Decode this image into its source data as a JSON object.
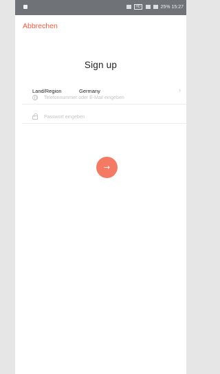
{
  "status_bar": {
    "right_text": "25% 15:27"
  },
  "nav": {
    "cancel_label": "Abbrechen"
  },
  "title": "Sign up",
  "region": {
    "label": "Land/Region",
    "value": "Germany",
    "chevron": "›"
  },
  "phone_field": {
    "placeholder": "Telefonnummer oder E-Mail eingeben",
    "value": ""
  },
  "password_field": {
    "placeholder": "Passwort eingeben",
    "value": ""
  },
  "submit": {
    "icon": "→"
  },
  "colors": {
    "accent": "#f2573f",
    "button": "#f47a64",
    "statusbar": "#6f7277"
  },
  "icons": [
    "globe-icon",
    "lock-icon",
    "arrow-right-icon",
    "chevron-right-icon"
  ]
}
